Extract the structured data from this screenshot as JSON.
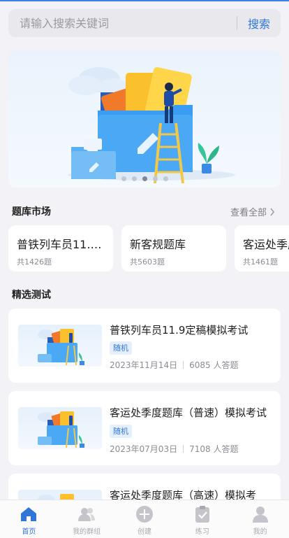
{
  "search": {
    "placeholder": "请输入搜索关键词",
    "button_label": "搜索"
  },
  "banner": {
    "dots": 5,
    "active_dot": 3
  },
  "market": {
    "title": "题库市场",
    "see_all": "查看全部",
    "cards": [
      {
        "title": "普铁列车员11.9...",
        "count": "共1426题"
      },
      {
        "title": "新客规题库",
        "count": "共5603题"
      },
      {
        "title": "客运处季度",
        "count": "共1461题"
      }
    ]
  },
  "featured": {
    "title": "精选测试",
    "items": [
      {
        "title": "普铁列车员11.9定稿模拟考试",
        "tag": "随机",
        "date": "2023年11月14日",
        "answers": "6085 人答题"
      },
      {
        "title": "客运处季度题库（普速）模拟考试",
        "tag": "随机",
        "date": "2023年07月03日",
        "answers": "7108 人答题"
      },
      {
        "title": "客运处季度题库（高速）模拟考",
        "tag": "",
        "date": "",
        "answers": ""
      }
    ]
  },
  "tabbar": {
    "items": [
      {
        "label": "首页",
        "icon": "home-icon",
        "active": true
      },
      {
        "label": "我的群组",
        "icon": "group-icon",
        "active": false
      },
      {
        "label": "创建",
        "icon": "plus-circle-icon",
        "active": false
      },
      {
        "label": "练习",
        "icon": "clipboard-check-icon",
        "active": false
      },
      {
        "label": "我的",
        "icon": "user-icon",
        "active": false
      }
    ]
  },
  "colors": {
    "accent": "#2f76d8",
    "background": "#f3f3f7",
    "inactive": "#a9a9b0"
  }
}
